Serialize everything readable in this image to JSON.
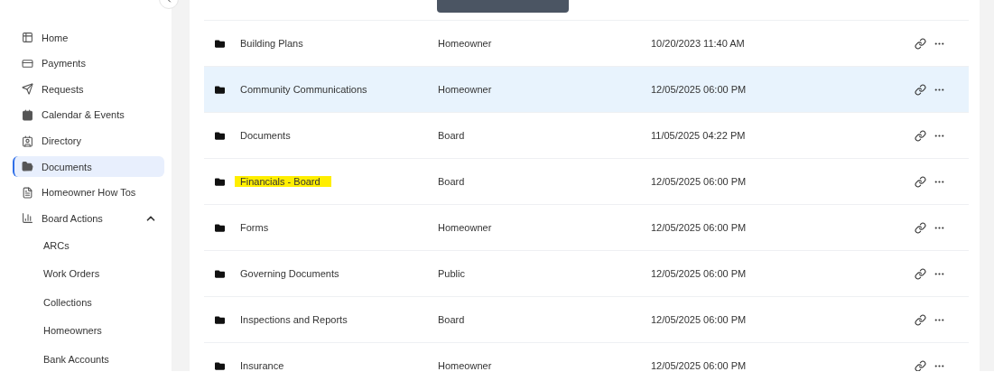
{
  "sidebar": {
    "items": [
      {
        "label": "Home",
        "selected": false
      },
      {
        "label": "Payments",
        "selected": false
      },
      {
        "label": "Requests",
        "selected": false
      },
      {
        "label": "Calendar & Events",
        "selected": false
      },
      {
        "label": "Directory",
        "selected": false
      },
      {
        "label": "Documents",
        "selected": true
      },
      {
        "label": "Homeowner How Tos",
        "selected": false
      },
      {
        "label": "Board Actions",
        "selected": false,
        "expanded": true,
        "children": [
          {
            "label": "ARCs",
            "selected": false
          },
          {
            "label": "Work Orders",
            "selected": false
          },
          {
            "label": "Collections",
            "selected": false
          },
          {
            "label": "Homeowners",
            "selected": false
          },
          {
            "label": "Bank Accounts",
            "selected": false
          }
        ]
      }
    ]
  },
  "table": {
    "rows": [
      {
        "name": "Building Plans",
        "access": "Homeowner",
        "modified": "10/20/2023 11:40 AM",
        "hovered": false,
        "highlighted": false
      },
      {
        "name": "Community Communications",
        "access": "Homeowner",
        "modified": "12/05/2025 06:00 PM",
        "hovered": true,
        "highlighted": false
      },
      {
        "name": "Documents",
        "access": "Board",
        "modified": "11/05/2025 04:22 PM",
        "hovered": false,
        "highlighted": false
      },
      {
        "name": "Financials - Board",
        "access": "Board",
        "modified": "12/05/2025 06:00 PM",
        "hovered": false,
        "highlighted": true
      },
      {
        "name": "Forms",
        "access": "Homeowner",
        "modified": "12/05/2025 06:00 PM",
        "hovered": false,
        "highlighted": false
      },
      {
        "name": "Governing Documents",
        "access": "Public",
        "modified": "12/05/2025 06:00 PM",
        "hovered": false,
        "highlighted": false
      },
      {
        "name": "Inspections and Reports",
        "access": "Board",
        "modified": "12/05/2025 06:00 PM",
        "hovered": false,
        "highlighted": false
      },
      {
        "name": "Insurance",
        "access": "Homeowner",
        "modified": "12/05/2025 06:00 PM",
        "hovered": false,
        "highlighted": false
      }
    ]
  }
}
